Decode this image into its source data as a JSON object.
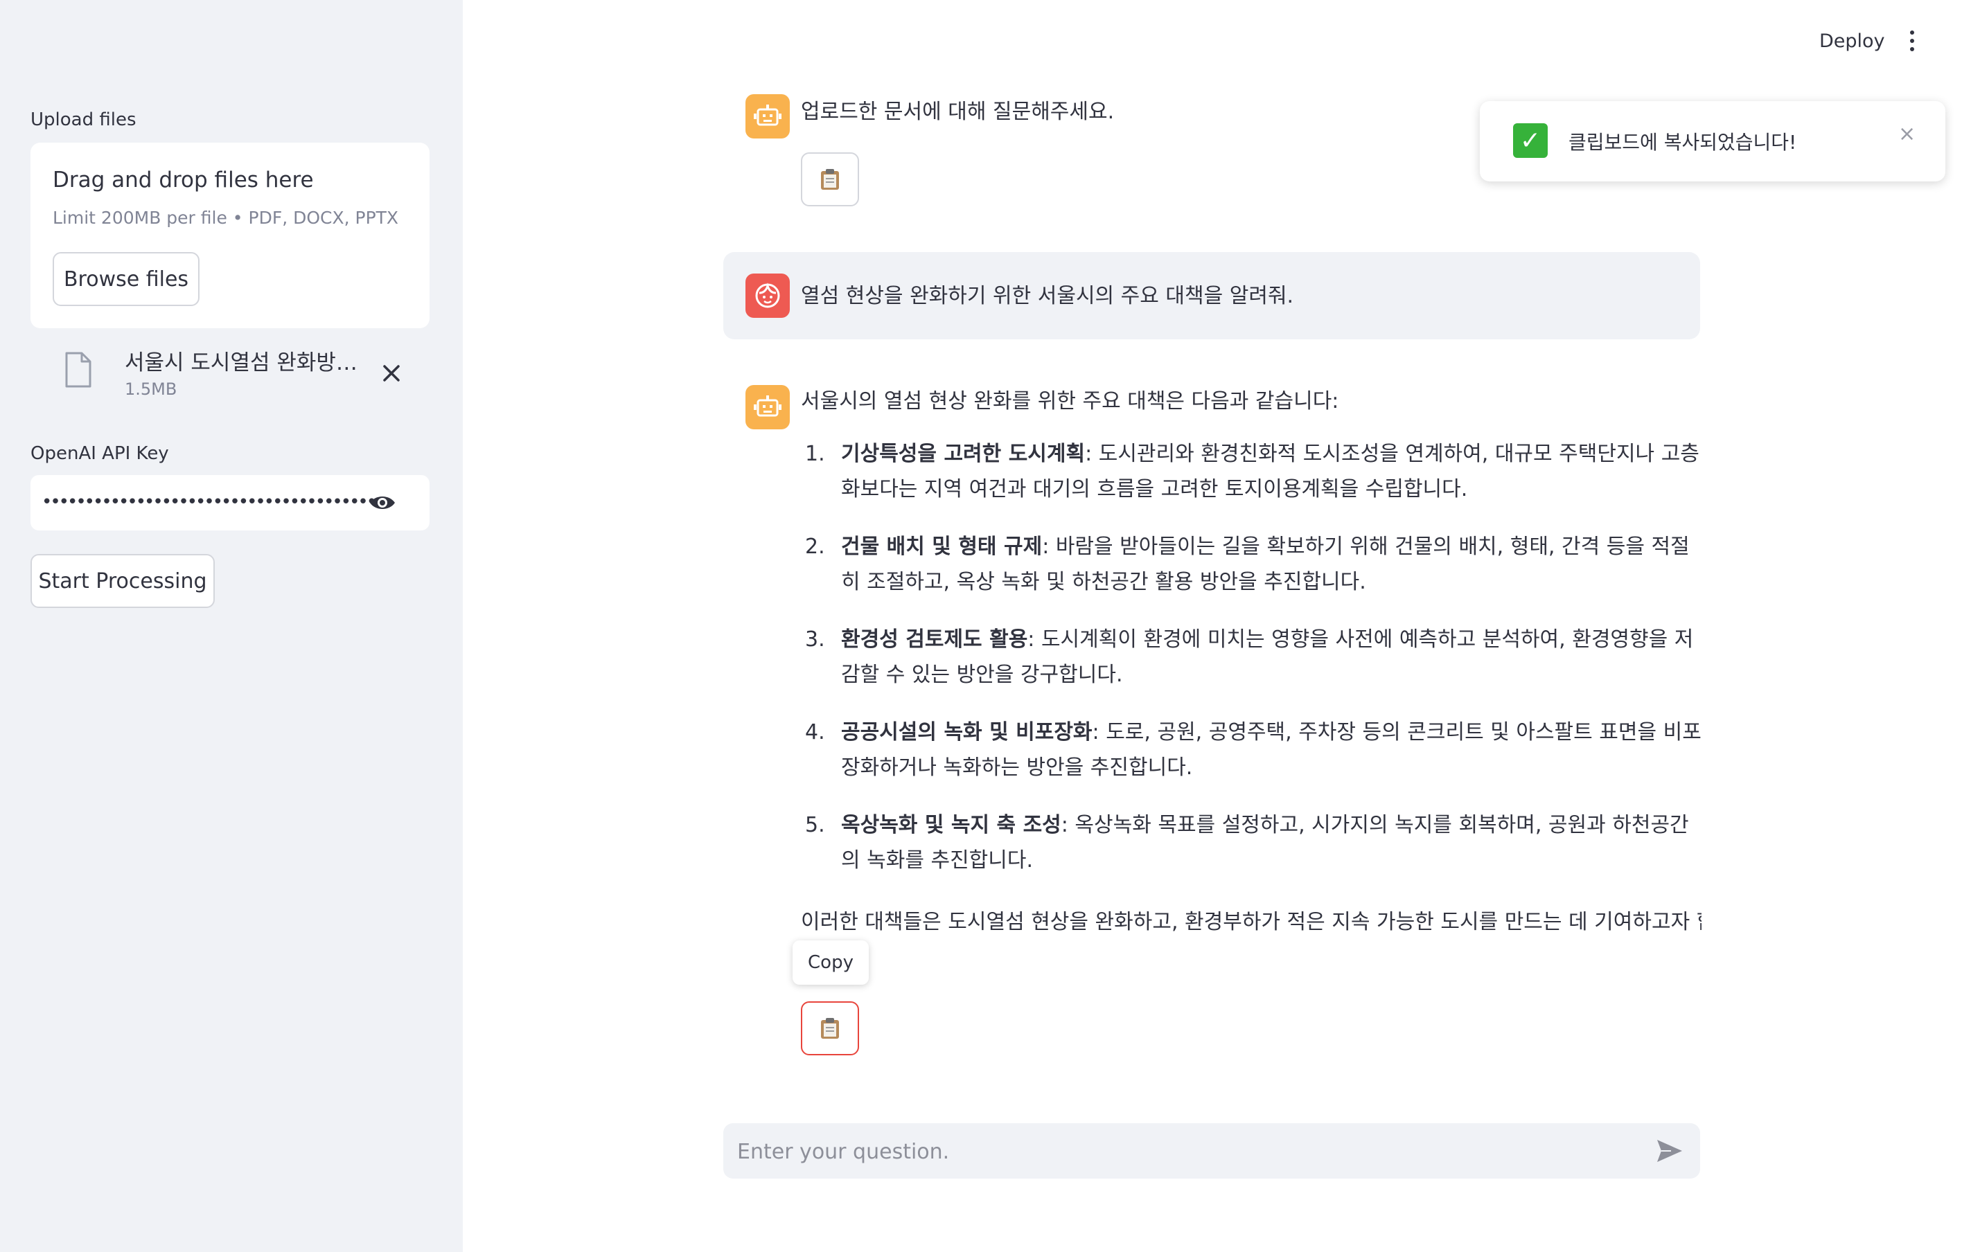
{
  "header": {
    "deploy_label": "Deploy"
  },
  "sidebar": {
    "upload_label": "Upload files",
    "dropzone_title": "Drag and drop files here",
    "dropzone_limit": "Limit 200MB per file • PDF, DOCX, PPTX",
    "browse_label": "Browse files",
    "file": {
      "name": "서울시 도시열섬 완화방안.…",
      "size": "1.5MB",
      "icon": "file-icon"
    },
    "api_key_label": "OpenAI API Key",
    "api_key_value": "••••••••••••••••••••••••••••••••••••••••••••••••••••",
    "start_label": "Start Processing"
  },
  "chat": {
    "greeting": "업로드한 문서에 대해 질문해주세요.",
    "user_question": "열섬 현상을 완화하기 위한 서울시의 주요 대책을 알려줘.",
    "answer_intro": "서울시의 열섬 현상 완화를 위한 주요 대책은 다음과 같습니다:",
    "answer_items": [
      {
        "num": "1.",
        "title": "기상특성을 고려한 도시계획",
        "text": ": 도시관리와 환경친화적 도시조성을 연계하여, 대규모 주택단지나 고층화보다는 지역 여건과 대기의 흐름을 고려한 토지이용계획을 수립합니다."
      },
      {
        "num": "2.",
        "title": "건물 배치 및 형태 규제",
        "text": ": 바람을 받아들이는 길을 확보하기 위해 건물의 배치, 형태, 간격 등을 적절히 조절하고, 옥상 녹화 및 하천공간 활용 방안을 추진합니다."
      },
      {
        "num": "3.",
        "title": "환경성 검토제도 활용",
        "text": ": 도시계획이 환경에 미치는 영향을 사전에 예측하고 분석하여, 환경영향을 저감할 수 있는 방안을 강구합니다."
      },
      {
        "num": "4.",
        "title": "공공시설의 녹화 및 비포장화",
        "text": ": 도로, 공원, 공영주택, 주차장 등의 콘크리트 및 아스팔트 표면을 비포장화하거나 녹화하는 방안을 추진합니다."
      },
      {
        "num": "5.",
        "title": "옥상녹화 및 녹지 축 조성",
        "text": ": 옥상녹화 목표를 설정하고, 시가지의 녹지를 회복하며, 공원과 하천공간의 녹화를 추진합니다."
      }
    ],
    "answer_conclusion": "이러한 대책들은 도시열섬 현상을 완화하고, 환경부하가 적은 지속 가능한 도시를 만드는 데 기여하고자 합",
    "copy_tooltip": "Copy",
    "input_placeholder": "Enter your question."
  },
  "toast": {
    "text": "클립보드에 복사되었습니다!",
    "close": "×",
    "check": "✓"
  },
  "colors": {
    "bot_avatar": "#f9b24e",
    "user_avatar": "#ee5a52",
    "sidebar_bg": "#f0f2f6",
    "toast_check": "#36b23a",
    "active_copy_border": "#e8453c"
  }
}
